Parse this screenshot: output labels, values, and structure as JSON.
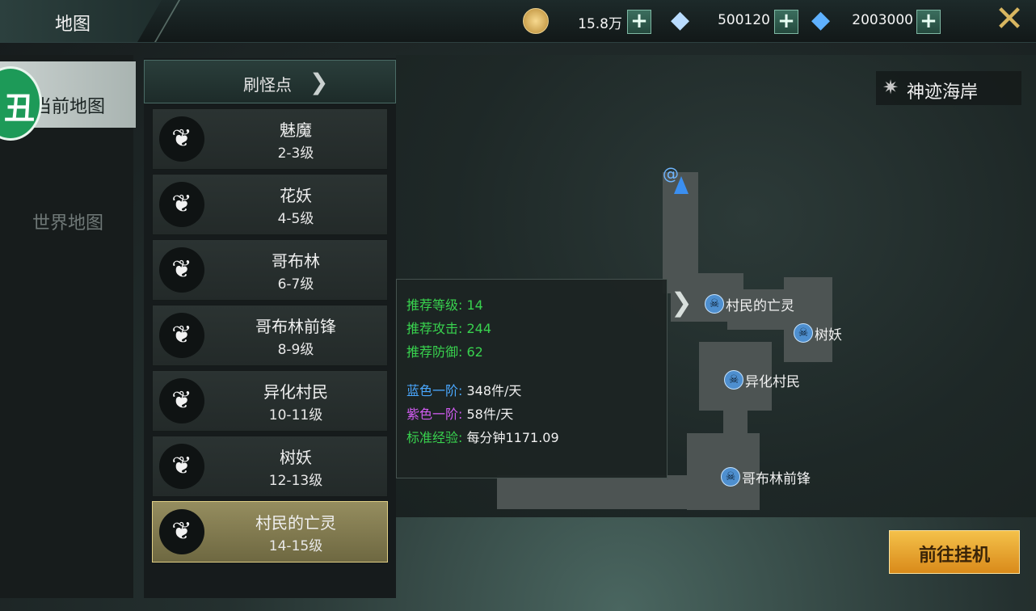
{
  "header": {
    "title": "地图"
  },
  "currencies": [
    {
      "icon": "gold-coin-icon",
      "value": "15.8万"
    },
    {
      "icon": "diamond-icon",
      "value": "500120"
    },
    {
      "icon": "blue-diamond-icon",
      "value": "2003000"
    }
  ],
  "tabs": {
    "current": "当前地图",
    "world": "世界地图",
    "badge": "丑"
  },
  "list": {
    "title": "刷怪点",
    "items": [
      {
        "name": "魅魔",
        "level": "2-3级"
      },
      {
        "name": "花妖",
        "level": "4-5级"
      },
      {
        "name": "哥布林",
        "level": "6-7级"
      },
      {
        "name": "哥布林前锋",
        "level": "8-9级"
      },
      {
        "name": "异化村民",
        "level": "10-11级"
      },
      {
        "name": "树妖",
        "level": "12-13级"
      },
      {
        "name": "村民的亡灵",
        "level": "14-15级"
      }
    ],
    "selected_index": 6
  },
  "map": {
    "region": "神迹海岸",
    "markers": [
      "村民的亡灵",
      "树妖",
      "异化村民",
      "哥布林前锋"
    ]
  },
  "info": {
    "rec_level_label": "推荐等级:",
    "rec_level": "14",
    "rec_attack_label": "推荐攻击:",
    "rec_attack": "244",
    "rec_defense_label": "推荐防御:",
    "rec_defense": "62",
    "blue_label": "蓝色一阶:",
    "blue_value": "348件/天",
    "purple_label": "紫色一阶:",
    "purple_value": "58件/天",
    "exp_label": "标准经验:",
    "exp_value": "每分钟1171.09"
  },
  "go_button": "前往挂机",
  "colors": {
    "accent_gold": "#f4c14a",
    "green": "#38d24e",
    "blue": "#4aa8ff",
    "purple": "#d05cf0"
  }
}
